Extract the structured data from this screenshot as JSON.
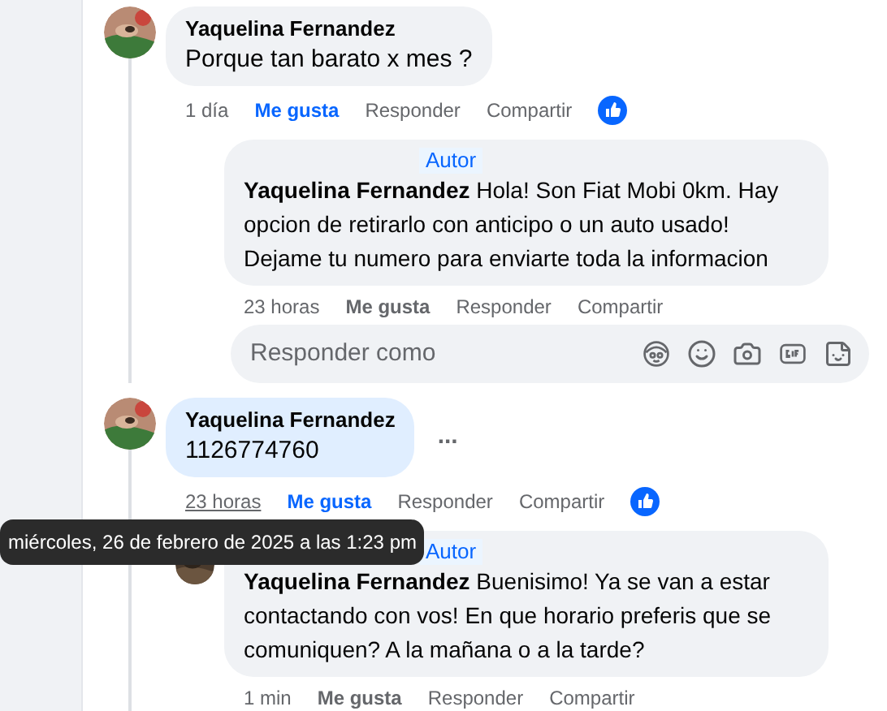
{
  "comments": [
    {
      "author": "Yaquelina Fernandez",
      "text": "Porque tan barato x mes ?",
      "highlighted": false,
      "time": "1 día",
      "time_hovered": false,
      "liked": true,
      "actions": [
        "Me gusta",
        "Responder",
        "Compartir"
      ],
      "replies": [
        {
          "badge": "Autor",
          "text": "**Yaquelina Fernandez** Hola! Son Fiat Mobi 0km. Hay opcion de retirarlo con anticipo o un auto usado! Dejame tu numero para enviarte toda la informacion",
          "time": "23 horas",
          "liked": false,
          "actions": [
            "Me gusta",
            "Responder",
            "Compartir"
          ]
        }
      ],
      "reply_box": {
        "placeholder": "Responder como"
      }
    },
    {
      "author": "Yaquelina Fernandez",
      "text": "1126774760",
      "highlighted": true,
      "time": "23 horas",
      "time_hovered": true,
      "liked": true,
      "actions": [
        "Me gusta",
        "Responder",
        "Compartir"
      ],
      "more_label": "...",
      "replies": [
        {
          "badge": "Autor",
          "text": "**Yaquelina Fernandez** Buenisimo! Ya se van a estar contactando con vos! En que horario preferis que se comuniquen? A la mañana o a la tarde?",
          "time": "1 min",
          "liked": false,
          "actions": [
            "Me gusta",
            "Responder",
            "Compartir"
          ]
        }
      ]
    }
  ],
  "tooltip": {
    "text": "miércoles, 26 de febrero de 2025 a las 1:23 pm"
  }
}
